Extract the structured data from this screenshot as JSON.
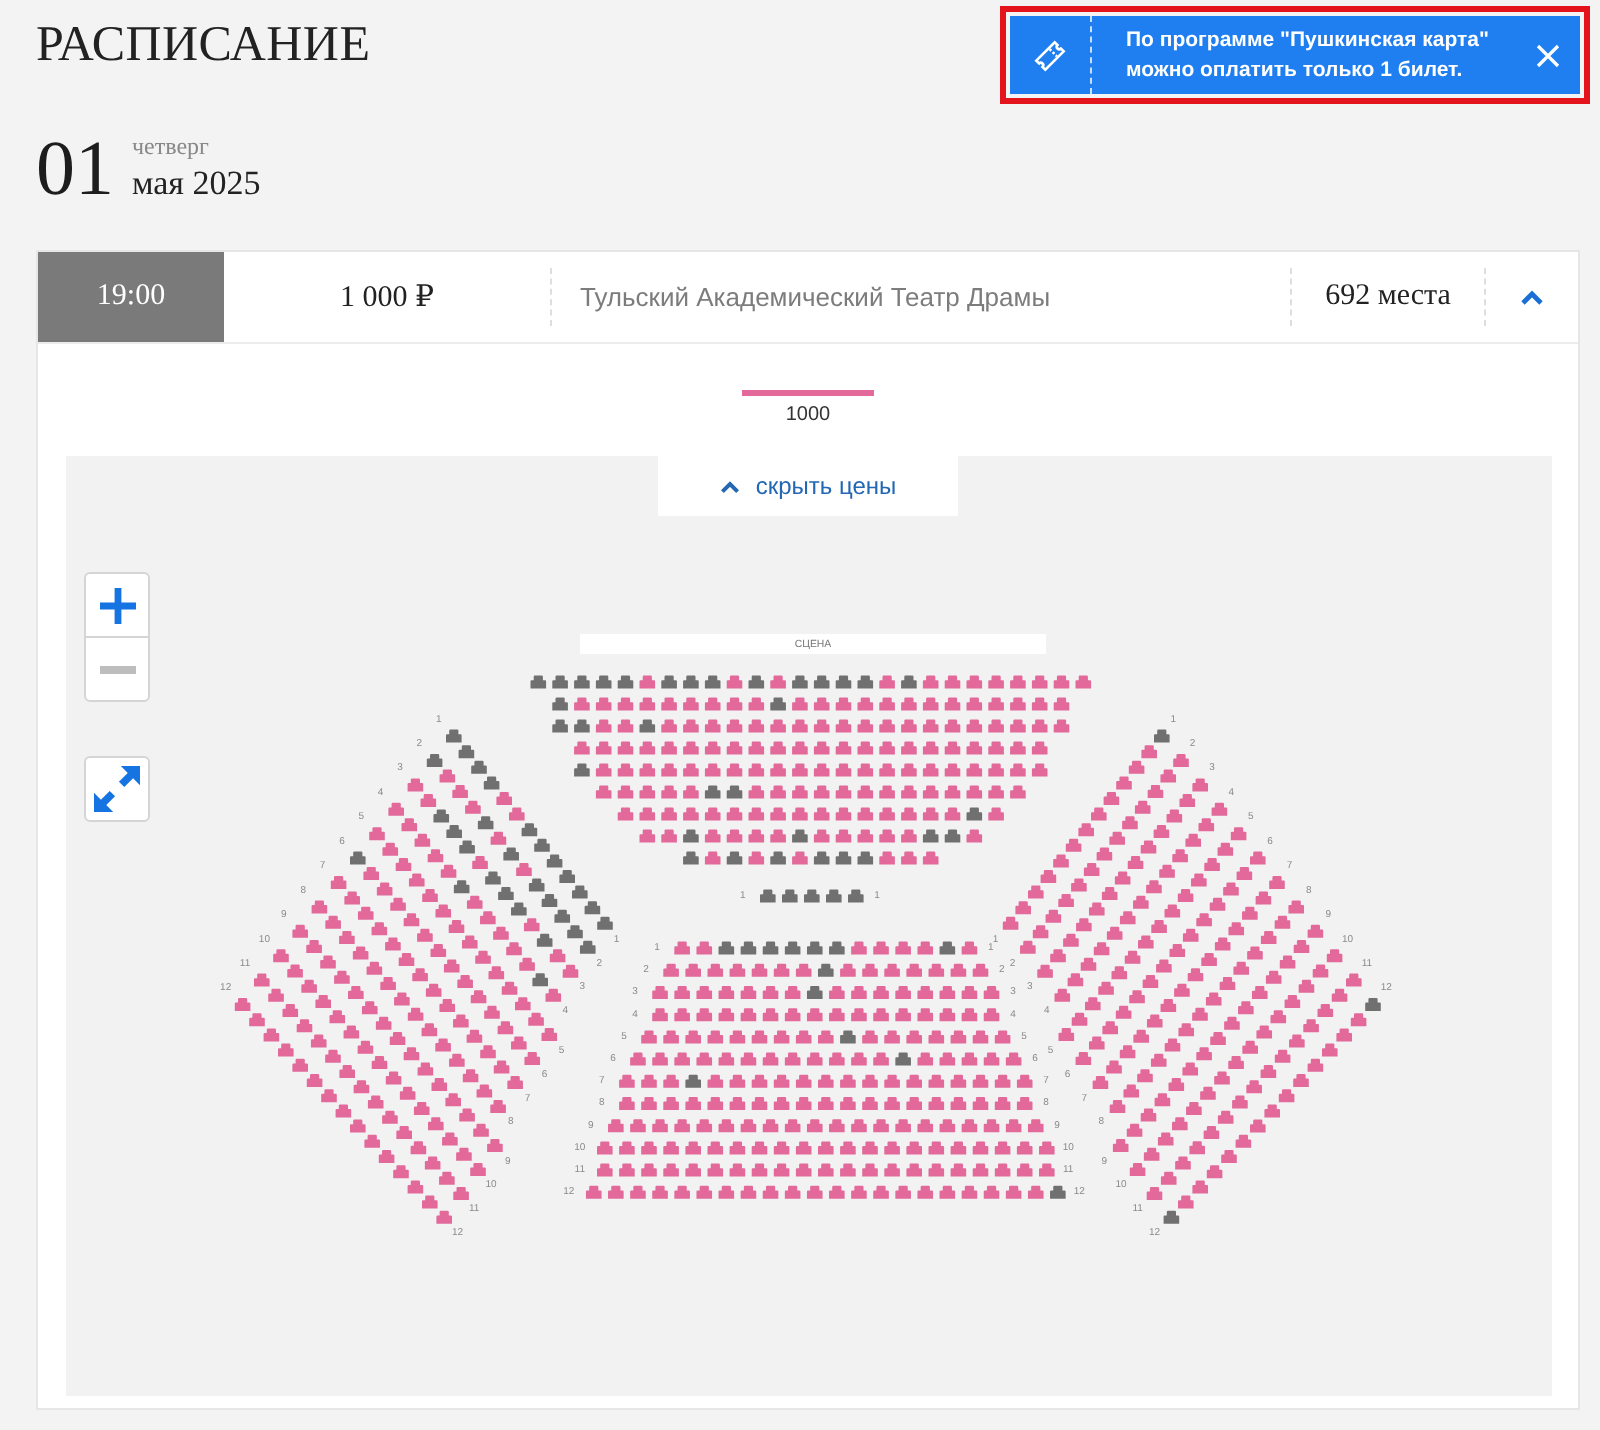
{
  "header": {
    "title": "РАСПИСАНИЕ"
  },
  "toast": {
    "text": "По программе \"Пушкинская карта\"\nможно оплатить только 1 билет.",
    "highlighted": true
  },
  "date": {
    "day": "01",
    "weekday": "четверг",
    "month_year": "мая 2025"
  },
  "session": {
    "time": "19:00",
    "price": "1 000 ₽",
    "venue": "Тульский Академический Театр Драмы",
    "seats_left": "692 места",
    "expanded": true
  },
  "price_legend": [
    {
      "label": "1000",
      "color": "#e2699a"
    }
  ],
  "price_toggle": {
    "label": "скрыть цены"
  },
  "zoom_controls": [
    {
      "kind": "in",
      "disabled": false
    },
    {
      "kind": "out",
      "disabled": true
    }
  ],
  "map": {
    "stage": "СЦЕНА",
    "sections": [
      {
        "kind": "block",
        "rows": [
          {
            "sold": [
              true,
              true,
              true,
              true,
              true,
              false,
              true,
              true,
              true,
              false,
              true,
              false,
              true,
              true,
              true,
              true,
              false,
              true,
              false,
              false,
              false,
              false,
              false,
              false,
              false,
              false
            ]
          },
          {
            "sold": [
              true,
              false,
              false,
              false,
              false,
              false,
              false,
              false,
              false,
              false,
              true,
              false,
              false,
              false,
              false,
              false,
              false,
              false,
              false,
              false,
              false,
              false,
              false,
              false
            ]
          },
          {
            "sold": [
              true,
              true,
              false,
              false,
              true,
              false,
              false,
              false,
              false,
              false,
              false,
              false,
              false,
              false,
              false,
              false,
              false,
              false,
              false,
              false,
              false,
              false,
              false,
              false
            ]
          },
          {
            "sold": [
              false,
              false,
              false,
              false,
              false,
              false,
              false,
              false,
              false,
              false,
              false,
              false,
              false,
              false,
              false,
              false,
              false,
              false,
              false,
              false,
              false,
              false
            ]
          },
          {
            "sold": [
              true,
              false,
              false,
              false,
              false,
              false,
              false,
              false,
              false,
              false,
              false,
              false,
              false,
              false,
              false,
              false,
              false,
              false,
              false,
              false,
              false,
              false
            ]
          },
          {
            "sold": [
              false,
              false,
              false,
              false,
              false,
              true,
              true,
              false,
              false,
              false,
              false,
              false,
              false,
              false,
              false,
              false,
              false,
              false,
              false,
              false
            ]
          },
          {
            "sold": [
              false,
              false,
              false,
              false,
              false,
              false,
              false,
              false,
              false,
              false,
              false,
              false,
              false,
              false,
              false,
              false,
              true,
              false
            ]
          },
          {
            "sold": [
              false,
              false,
              true,
              false,
              false,
              false,
              false,
              true,
              false,
              false,
              false,
              false,
              false,
              true,
              true,
              false
            ]
          },
          {
            "sold": [
              true,
              false,
              true,
              false,
              true,
              false,
              true,
              true,
              true,
              false,
              false,
              false
            ]
          }
        ]
      },
      {
        "kind": "block",
        "rows": [
          {
            "label_start": "1",
            "label_end": "1",
            "sold": [
              true,
              true,
              true,
              true,
              true
            ]
          }
        ]
      },
      {
        "kind": "block",
        "rows": [
          {
            "label_start": "1",
            "label_end": "1",
            "sold": [
              false,
              false,
              true,
              true,
              true,
              true,
              true,
              true,
              false,
              false,
              false,
              false,
              true,
              false
            ]
          },
          {
            "label_start": "2",
            "label_end": "2",
            "sold": [
              false,
              false,
              false,
              false,
              false,
              false,
              false,
              true,
              false,
              false,
              false,
              false,
              false,
              false,
              false
            ]
          },
          {
            "label_start": "3",
            "label_end": "3",
            "sold": [
              false,
              false,
              false,
              false,
              false,
              false,
              false,
              true,
              false,
              false,
              false,
              false,
              false,
              false,
              false,
              false
            ]
          },
          {
            "label_start": "4",
            "label_end": "4",
            "sold": [
              false,
              false,
              false,
              false,
              false,
              false,
              false,
              false,
              false,
              false,
              false,
              false,
              false,
              false,
              false,
              false
            ]
          },
          {
            "label_start": "5",
            "label_end": "5",
            "sold": [
              false,
              false,
              false,
              false,
              false,
              false,
              false,
              false,
              false,
              true,
              false,
              false,
              false,
              false,
              false,
              false,
              false
            ]
          },
          {
            "label_start": "6",
            "label_end": "6",
            "sold": [
              false,
              false,
              false,
              false,
              false,
              false,
              false,
              false,
              false,
              false,
              false,
              false,
              true,
              false,
              false,
              false,
              false,
              false
            ]
          },
          {
            "label_start": "7",
            "label_end": "7",
            "sold": [
              false,
              false,
              false,
              true,
              false,
              false,
              false,
              false,
              false,
              false,
              false,
              false,
              false,
              false,
              false,
              false,
              false,
              false,
              false
            ]
          },
          {
            "label_start": "8",
            "label_end": "8",
            "sold": [
              false,
              false,
              false,
              false,
              false,
              false,
              false,
              false,
              false,
              false,
              false,
              false,
              false,
              false,
              false,
              false,
              false,
              false,
              false
            ]
          },
          {
            "label_start": "9",
            "label_end": "9",
            "sold": [
              false,
              false,
              false,
              false,
              false,
              false,
              false,
              false,
              false,
              false,
              false,
              false,
              false,
              false,
              false,
              false,
              false,
              false,
              false,
              false
            ]
          },
          {
            "label_start": "10",
            "label_end": "10",
            "sold": [
              false,
              false,
              false,
              false,
              false,
              false,
              false,
              false,
              false,
              false,
              false,
              false,
              false,
              false,
              false,
              false,
              false,
              false,
              false,
              false,
              false
            ]
          },
          {
            "label_start": "11",
            "label_end": "11",
            "sold": [
              false,
              false,
              false,
              false,
              false,
              false,
              false,
              false,
              false,
              false,
              false,
              false,
              false,
              false,
              false,
              false,
              false,
              false,
              false,
              false,
              false
            ]
          },
          {
            "label_start": "12",
            "label_end": "12",
            "sold": [
              false,
              false,
              false,
              false,
              false,
              false,
              false,
              false,
              false,
              false,
              false,
              false,
              false,
              false,
              false,
              false,
              false,
              false,
              false,
              false,
              false,
              true
            ]
          }
        ]
      },
      {
        "kind": "wing-left",
        "rows": [
          {
            "label_start": "1",
            "label_end": "1",
            "sold": [
              true,
              true,
              true,
              true,
              false,
              false,
              true,
              true,
              true,
              true,
              true,
              true,
              true
            ]
          },
          {
            "label_start": "2",
            "label_end": "2",
            "sold": [
              true,
              false,
              false,
              false,
              true,
              false,
              true,
              false,
              true,
              true,
              true,
              true,
              true
            ]
          },
          {
            "label_start": "3",
            "label_end": "3",
            "sold": [
              false,
              false,
              true,
              true,
              true,
              false,
              true,
              true,
              true,
              false,
              true,
              false,
              false
            ]
          },
          {
            "label_start": "4",
            "label_end": "4",
            "sold": [
              false,
              false,
              false,
              false,
              false,
              true,
              false,
              false,
              false,
              false,
              false,
              true,
              false
            ]
          },
          {
            "label_start": "5",
            "label_end": "5",
            "sold": [
              false,
              false,
              false,
              false,
              false,
              false,
              false,
              false,
              false,
              false,
              false,
              false,
              false,
              false
            ]
          },
          {
            "label_start": "6",
            "label_end": "6",
            "sold": [
              true,
              false,
              false,
              false,
              false,
              false,
              false,
              false,
              false,
              false,
              false,
              false,
              false,
              false
            ]
          },
          {
            "label_start": "7",
            "label_end": "7",
            "sold": [
              false,
              false,
              false,
              false,
              false,
              false,
              false,
              false,
              false,
              false,
              false,
              false,
              false,
              false
            ]
          },
          {
            "label_start": "8",
            "label_end": "8",
            "sold": [
              false,
              false,
              false,
              false,
              false,
              false,
              false,
              false,
              false,
              false,
              false,
              false,
              false,
              false
            ]
          },
          {
            "label_start": "9",
            "label_end": "9",
            "sold": [
              false,
              false,
              false,
              false,
              false,
              false,
              false,
              false,
              false,
              false,
              false,
              false,
              false,
              false,
              false
            ]
          },
          {
            "label_start": "10",
            "label_end": "10",
            "sold": [
              false,
              false,
              false,
              false,
              false,
              false,
              false,
              false,
              false,
              false,
              false,
              false,
              false,
              false,
              false
            ]
          },
          {
            "label_start": "11",
            "label_end": "11",
            "sold": [
              false,
              false,
              false,
              false,
              false,
              false,
              false,
              false,
              false,
              false,
              false,
              false,
              false,
              false,
              false
            ]
          },
          {
            "label_start": "12",
            "label_end": "12",
            "sold": [
              false,
              false,
              false,
              false,
              false,
              false,
              false,
              false,
              false,
              false,
              false,
              false,
              false,
              false,
              false
            ]
          }
        ]
      },
      {
        "kind": "wing-right",
        "rows": [
          {
            "label_start": "1",
            "label_end": "1",
            "sold": [
              true,
              false,
              false,
              false,
              false,
              false,
              false,
              false,
              false,
              false,
              false,
              false,
              false
            ]
          },
          {
            "label_start": "2",
            "label_end": "2",
            "sold": [
              false,
              false,
              false,
              false,
              false,
              false,
              false,
              false,
              false,
              false,
              false,
              false,
              false
            ]
          },
          {
            "label_start": "3",
            "label_end": "3",
            "sold": [
              false,
              false,
              false,
              false,
              false,
              false,
              false,
              false,
              false,
              false,
              false,
              false,
              false
            ]
          },
          {
            "label_start": "4",
            "label_end": "4",
            "sold": [
              false,
              false,
              false,
              false,
              false,
              false,
              false,
              false,
              false,
              false,
              false,
              false,
              false
            ]
          },
          {
            "label_start": "5",
            "label_end": "5",
            "sold": [
              false,
              false,
              false,
              false,
              false,
              false,
              false,
              false,
              false,
              false,
              false,
              false,
              false,
              false
            ]
          },
          {
            "label_start": "6",
            "label_end": "6",
            "sold": [
              false,
              false,
              false,
              false,
              false,
              false,
              false,
              false,
              false,
              false,
              false,
              false,
              false,
              false
            ]
          },
          {
            "label_start": "7",
            "label_end": "7",
            "sold": [
              false,
              false,
              false,
              false,
              false,
              false,
              false,
              false,
              false,
              false,
              false,
              false,
              false,
              false
            ]
          },
          {
            "label_start": "8",
            "label_end": "8",
            "sold": [
              false,
              false,
              false,
              false,
              false,
              false,
              false,
              false,
              false,
              false,
              false,
              false,
              false,
              false
            ]
          },
          {
            "label_start": "9",
            "label_end": "9",
            "sold": [
              false,
              false,
              false,
              false,
              false,
              false,
              false,
              false,
              false,
              false,
              false,
              false,
              false,
              false,
              false
            ]
          },
          {
            "label_start": "10",
            "label_end": "10",
            "sold": [
              false,
              false,
              false,
              false,
              false,
              false,
              false,
              false,
              false,
              false,
              false,
              false,
              false,
              false,
              false
            ]
          },
          {
            "label_start": "11",
            "label_end": "11",
            "sold": [
              false,
              false,
              false,
              false,
              false,
              false,
              false,
              false,
              false,
              false,
              false,
              false,
              false,
              false,
              false
            ]
          },
          {
            "label_start": "12",
            "label_end": "12",
            "sold": [
              true,
              false,
              false,
              false,
              false,
              false,
              false,
              false,
              false,
              false,
              false,
              false,
              false,
              false,
              true
            ]
          }
        ]
      }
    ]
  }
}
